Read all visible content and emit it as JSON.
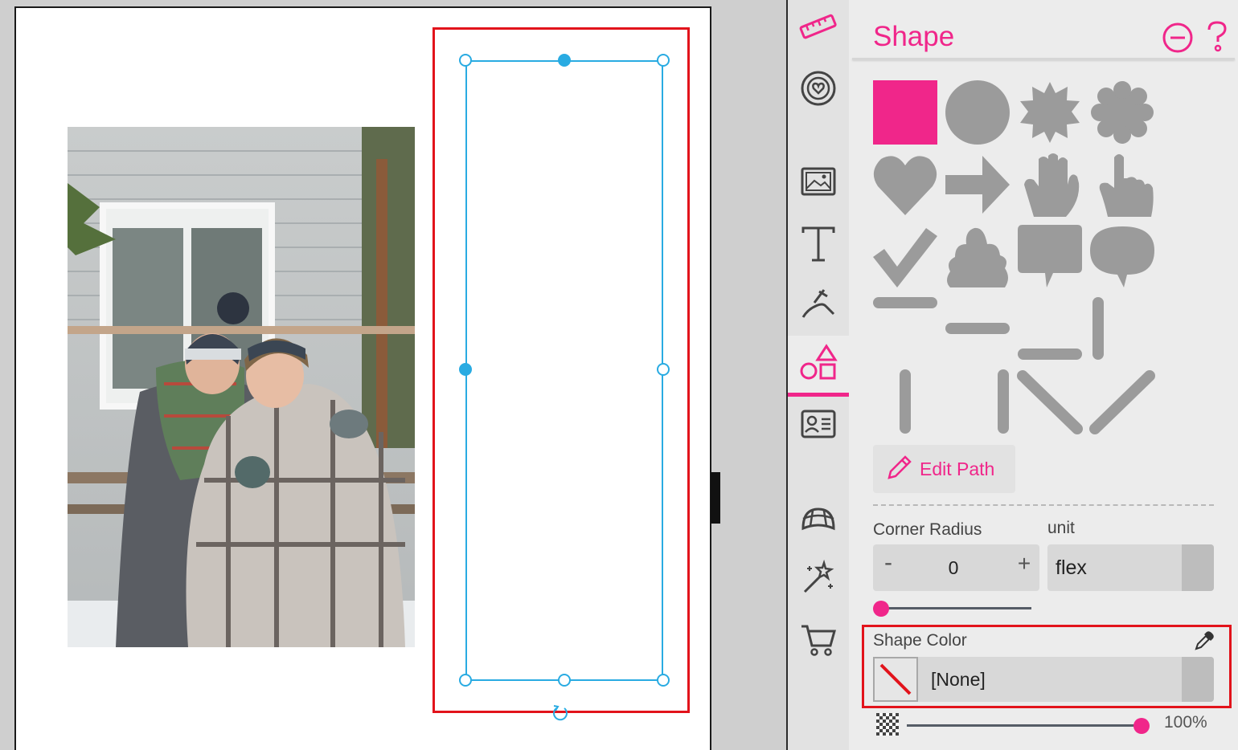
{
  "panel": {
    "title": "Shape",
    "accent_color": "#f0268a",
    "header_icons": [
      "collapse-panel-icon",
      "help-icon"
    ]
  },
  "toolbar": {
    "tools": [
      {
        "name": "ruler-icon",
        "active": false
      },
      {
        "name": "stickers-heart-icon",
        "active": false
      },
      {
        "name": "image-icon",
        "active": false
      },
      {
        "name": "text-icon",
        "active": false
      },
      {
        "name": "draw-tool-icon",
        "active": false
      },
      {
        "name": "shapes-icon",
        "active": true
      },
      {
        "name": "contact-card-icon",
        "active": false
      },
      {
        "name": "perspective-icon",
        "active": false
      },
      {
        "name": "magic-wand-icon",
        "active": false
      },
      {
        "name": "cart-icon",
        "active": false
      }
    ]
  },
  "shapes": {
    "items": [
      "square",
      "circle",
      "starburst",
      "scalloped-circle",
      "heart",
      "arrow",
      "hand",
      "pointing-hand",
      "checkmark",
      "cloud",
      "speech-bubble-square",
      "speech-bubble-oval",
      "line-horizontal-1",
      "line-horizontal-2",
      "line-horizontal-3",
      "line-vertical-1",
      "line-vertical-2",
      "line-vertical-3",
      "line-diagonal-down",
      "line-diagonal-up"
    ],
    "selected": "square",
    "selected_color": "#f0268a",
    "default_color": "#9b9b9b"
  },
  "edit_path": {
    "label": "Edit Path"
  },
  "corner_radius": {
    "label": "Corner Radius",
    "minus": "-",
    "plus": "+",
    "value": "0",
    "slider_fraction": 0
  },
  "unit": {
    "label": "unit",
    "value": "flex"
  },
  "shape_color": {
    "label": "Shape Color",
    "value": "[None]"
  },
  "opacity": {
    "value": "100%",
    "fraction": 1.0
  },
  "canvas": {
    "selection_color": "#29abe2",
    "highlight_color": "#e2131b"
  }
}
